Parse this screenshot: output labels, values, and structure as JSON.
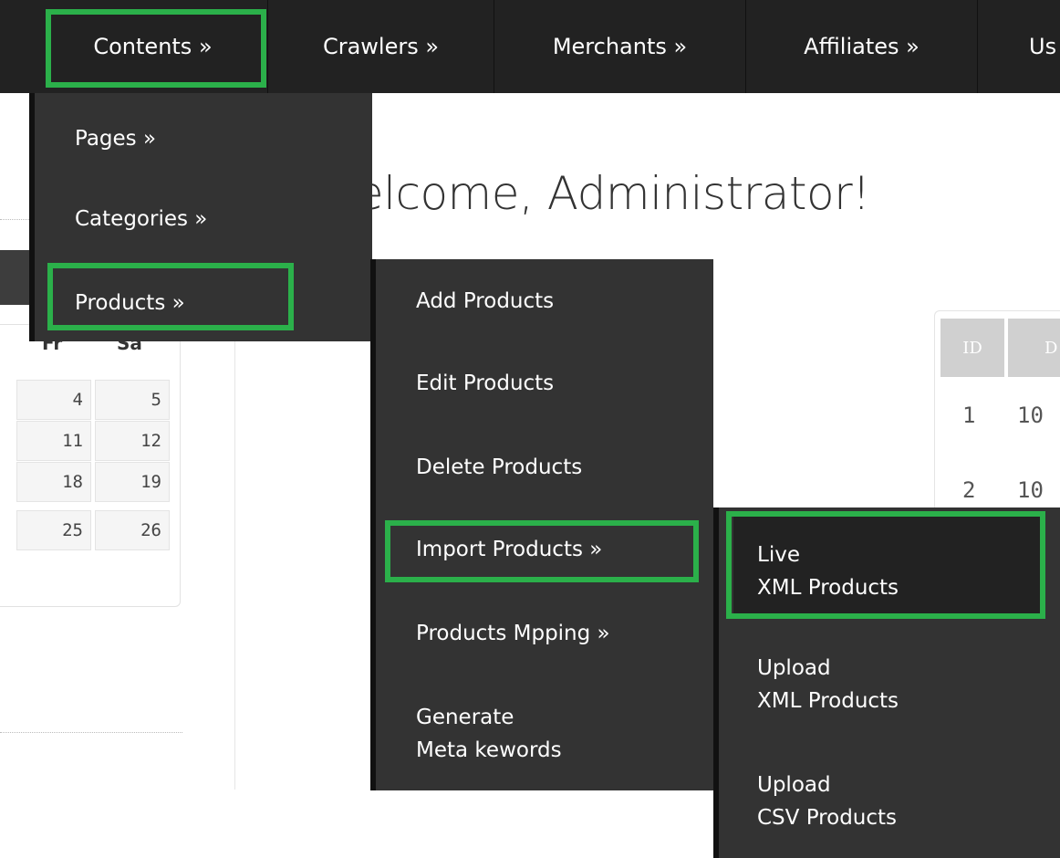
{
  "topnav": {
    "items": [
      {
        "label": "Contents »"
      },
      {
        "label": "Crawlers »"
      },
      {
        "label": "Merchants »"
      },
      {
        "label": "Affiliates »"
      },
      {
        "label": "Us"
      }
    ]
  },
  "contents_menu": {
    "items": [
      {
        "label": "Pages »"
      },
      {
        "label": "Categories »"
      },
      {
        "label": "Products »"
      }
    ]
  },
  "products_menu": {
    "items": [
      {
        "label": "Add Products"
      },
      {
        "label": "Edit Products"
      },
      {
        "label": "Delete Products"
      },
      {
        "label": "Import Products »"
      },
      {
        "label": "Products Mpping »"
      },
      {
        "label_line1": "Generate",
        "label_line2": "Meta kewords"
      }
    ]
  },
  "import_menu": {
    "items": [
      {
        "label_line1": "Live",
        "label_line2": "XML Products"
      },
      {
        "label_line1": "Upload",
        "label_line2": "XML Products"
      },
      {
        "label_line1": "Upload",
        "label_line2": "CSV Products"
      }
    ]
  },
  "welcome": {
    "text": "Velcome, Administrator!"
  },
  "calendar": {
    "headers": [
      "Fr",
      "Sa"
    ],
    "rows": [
      [
        "4",
        "5"
      ],
      [
        "11",
        "12"
      ],
      [
        "18",
        "19"
      ],
      [
        "25",
        "26"
      ]
    ]
  },
  "table": {
    "headers": [
      "ID",
      "D"
    ],
    "rows": [
      [
        "1",
        "10"
      ],
      [
        "2",
        "10"
      ]
    ]
  },
  "colors": {
    "highlight": "#2bb04a",
    "nav_bg": "#222222",
    "menu_bg": "#333333"
  }
}
